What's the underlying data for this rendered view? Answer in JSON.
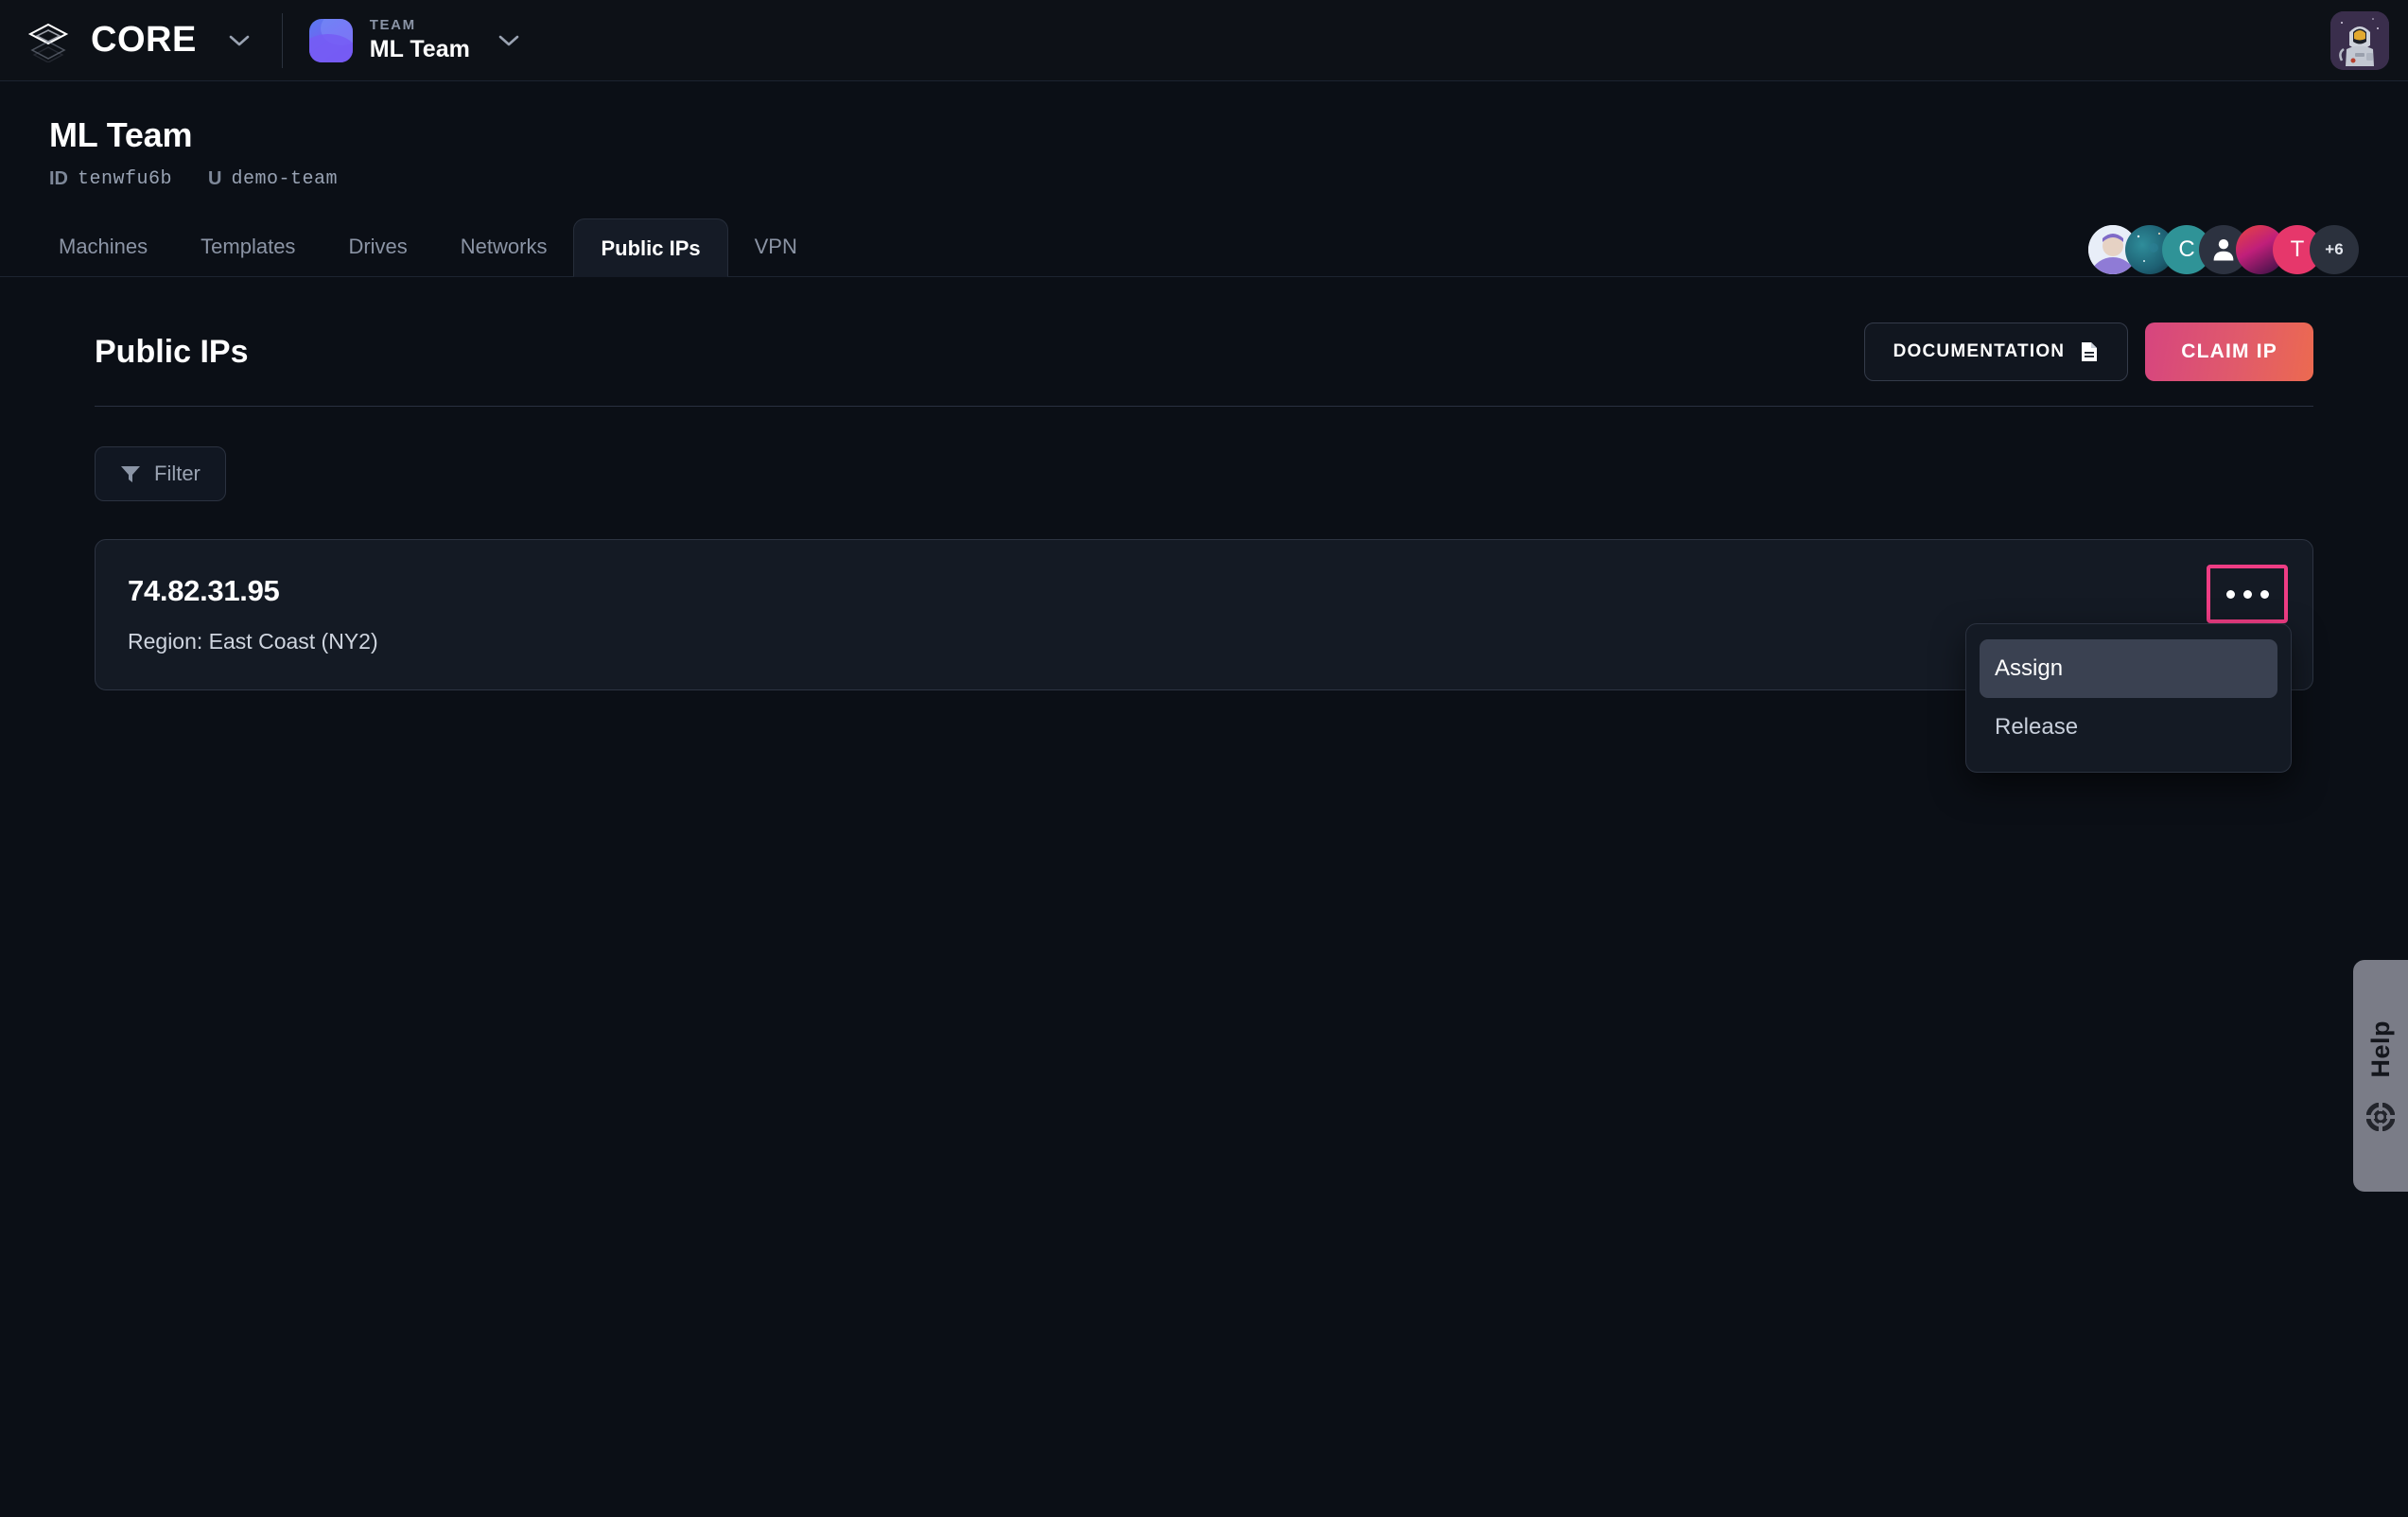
{
  "topbar": {
    "logo_icon": "stacked-layers-logo-icon",
    "brand_name": "CORE",
    "brand_chevron_icon": "chevron-down-icon",
    "team_label": "TEAM",
    "team_name": "ML Team",
    "team_chevron_icon": "chevron-down-icon",
    "team_icon": "team-gradient-icon",
    "user_avatar_icon": "astronaut-avatar-icon"
  },
  "page_header": {
    "title": "ML Team",
    "id_key": "ID",
    "id_value": "tenwfu6b",
    "url_key": "U",
    "url_value": "demo-team",
    "members": [
      {
        "type": "photo",
        "label": ""
      },
      {
        "type": "nebula",
        "label": ""
      },
      {
        "type": "initial",
        "label": "C"
      },
      {
        "type": "person",
        "label": ""
      },
      {
        "type": "gradient",
        "label": ""
      },
      {
        "type": "initial",
        "label": "T"
      },
      {
        "type": "count",
        "label": "+6"
      }
    ]
  },
  "tabs": [
    {
      "label": "Machines",
      "active": false
    },
    {
      "label": "Templates",
      "active": false
    },
    {
      "label": "Drives",
      "active": false
    },
    {
      "label": "Networks",
      "active": false
    },
    {
      "label": "Public IPs",
      "active": true
    },
    {
      "label": "VPN",
      "active": false
    }
  ],
  "section": {
    "title": "Public IPs",
    "documentation_label": "DOCUMENTATION",
    "documentation_icon": "document-icon",
    "claim_label": "CLAIM IP",
    "filter_label": "Filter",
    "filter_icon": "funnel-icon"
  },
  "ip_list": [
    {
      "address": "74.82.31.95",
      "region": "Region: East Coast (NY2)",
      "menu_icon": "ellipsis-horizontal-icon"
    }
  ],
  "dropdown": {
    "items": [
      {
        "label": "Assign",
        "hover": true
      },
      {
        "label": "Release",
        "hover": false
      }
    ]
  },
  "help": {
    "label": "Help",
    "icon": "lifebuoy-icon"
  },
  "colors": {
    "accent_pink": "#ef3d84",
    "claim_gradient_start": "#d6457f",
    "claim_gradient_end": "#ec6a50",
    "background": "#0b0f16",
    "card_background": "#141a24"
  }
}
